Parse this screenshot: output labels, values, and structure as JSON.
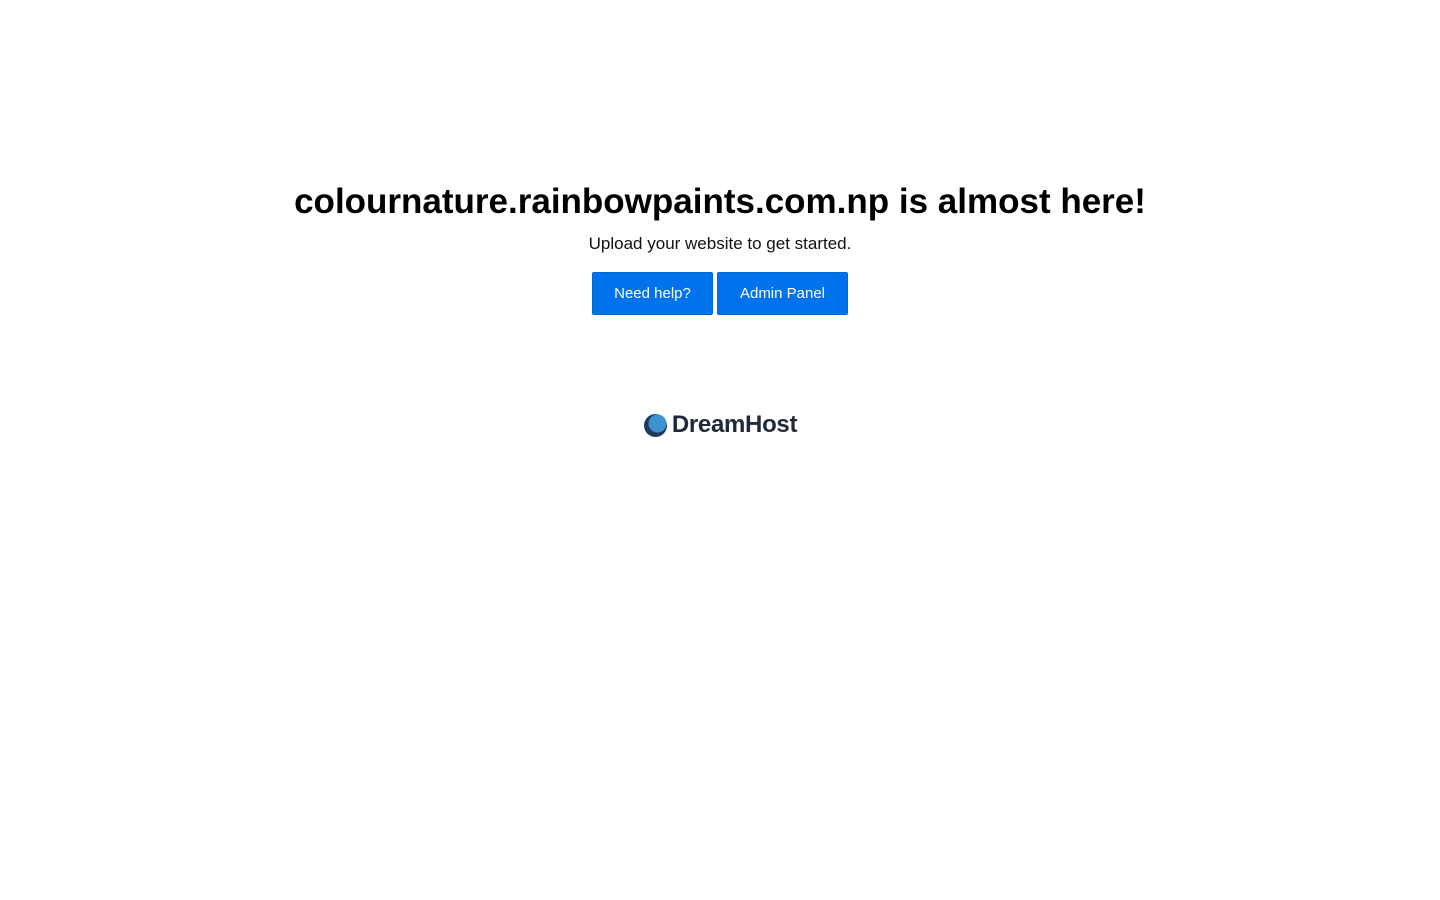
{
  "headline": "colournature.rainbowpaints.com.np is almost here!",
  "subtitle": "Upload your website to get started.",
  "buttons": {
    "help_label": "Need help?",
    "admin_label": "Admin Panel"
  },
  "brand": {
    "name": "DreamHost",
    "logo_icon": "dreamhost-moon-icon"
  },
  "colors": {
    "button_bg": "#0073ec",
    "brand_text": "#1e2a3a",
    "brand_mark": "#2f6fa8"
  }
}
